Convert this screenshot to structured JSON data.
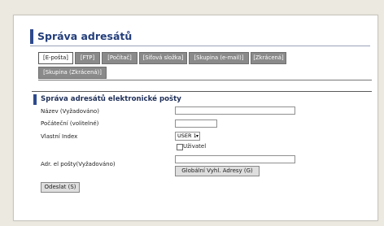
{
  "page": {
    "title": "Správa adresátů",
    "section_title": "Správa adresátů elektronické pošty"
  },
  "tabs": [
    {
      "label": "[E-pošta]",
      "active": true
    },
    {
      "label": "[FTP]",
      "active": false
    },
    {
      "label": "[Počítač]",
      "active": false
    },
    {
      "label": "[Síťová složka]",
      "active": false
    },
    {
      "label": "[Skupina (e-mail)]",
      "active": false
    },
    {
      "label": "[Zkrácená]",
      "active": false
    },
    {
      "label": "[Skupina (Zkrácená)]",
      "active": false
    }
  ],
  "form": {
    "name_label": "Název (Vyžadováno)",
    "name_value": "",
    "initial_label": "Počáteční (volitelné)",
    "initial_value": "",
    "index_label": "Vlastní Index",
    "index_value": "USER 1",
    "user_checkbox_label": "Uživatel",
    "user_checked": false,
    "email_label": "Adr. el pošty(Vyžadováno)",
    "email_value": "",
    "global_button": "Globální Vyhl. Adresy (G)",
    "submit_button": "Odeslat (S)"
  },
  "colors": {
    "accent": "#2e4a8c",
    "tab_inactive": "#8a8a8a"
  }
}
